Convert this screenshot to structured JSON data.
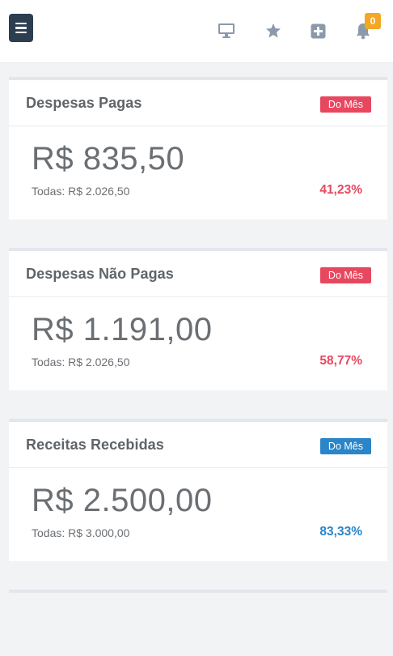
{
  "topbar": {
    "icons": [
      "menu-icon",
      "monitor-icon",
      "star-icon",
      "plus-square-icon",
      "bell-icon"
    ],
    "notification_count": "0"
  },
  "cards": [
    {
      "title": "Despesas Pagas",
      "badge": "Do Mês",
      "badge_color": "#e8485f",
      "amount": "R$ 835,50",
      "total": "Todas: R$ 2.026,50",
      "percent": "41,23%",
      "percent_color": "#e8485f"
    },
    {
      "title": "Despesas Não Pagas",
      "badge": "Do Mês",
      "badge_color": "#e8485f",
      "amount": "R$ 1.191,00",
      "total": "Todas: R$ 2.026,50",
      "percent": "58,77%",
      "percent_color": "#e8485f"
    },
    {
      "title": "Receitas Recebidas",
      "badge": "Do Mês",
      "badge_color": "#2a86c8",
      "amount": "R$ 2.500,00",
      "total": "Todas: R$ 3.000,00",
      "percent": "83,33%",
      "percent_color": "#2a86c8"
    }
  ]
}
